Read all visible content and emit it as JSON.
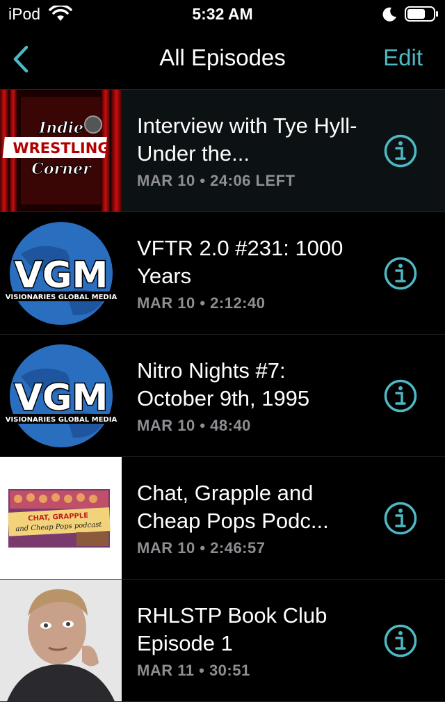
{
  "status": {
    "carrier": "iPod",
    "time": "5:32 AM"
  },
  "nav": {
    "title": "All Episodes",
    "edit_label": "Edit"
  },
  "episodes": [
    {
      "title": "Interview with Tye Hyll- Under the...",
      "date": "MAR 10",
      "duration": "24:06 LEFT",
      "art": {
        "line1": "Indie",
        "line2": "WRESTLING",
        "line3": "Corner"
      }
    },
    {
      "title": "VFTR 2.0 #231: 1000 Years",
      "date": "MAR 10",
      "duration": "2:12:40",
      "art": {
        "logo": "VGM",
        "caption": "VISIONARIES GLOBAL MEDIA"
      }
    },
    {
      "title": "Nitro Nights #7: October 9th, 1995",
      "date": "MAR 10",
      "duration": "48:40",
      "art": {
        "logo": "VGM",
        "caption": "VISIONARIES GLOBAL MEDIA"
      }
    },
    {
      "title": "Chat, Grapple and Cheap Pops Podc...",
      "date": "MAR 10",
      "duration": "2:46:57",
      "art": {
        "line1": "CHAT, GRAPPLE",
        "line2": "and Cheap Pops podcast"
      }
    },
    {
      "title": "RHLSTP Book Club Episode 1",
      "date": "MAR 11",
      "duration": "30:51"
    }
  ],
  "meta_separator": "•",
  "colors": {
    "accent": "#4db9c4",
    "background": "#000000",
    "secondary_text": "#8e8e93"
  },
  "icons": [
    "wifi-icon",
    "moon-icon",
    "battery-icon",
    "chevron-left-icon",
    "info-icon"
  ]
}
